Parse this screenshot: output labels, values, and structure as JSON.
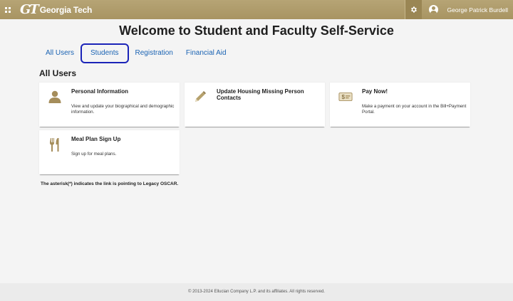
{
  "header": {
    "logo_mark": "GT",
    "logo_text": "Georgia Tech",
    "user_name": "George Patrick Burdell"
  },
  "page": {
    "title": "Welcome to Student and Faculty Self-Service",
    "tabs": [
      {
        "label": "All Users",
        "selected": false
      },
      {
        "label": "Students",
        "selected": true
      },
      {
        "label": "Registration",
        "selected": false
      },
      {
        "label": "Financial Aid",
        "selected": false
      }
    ],
    "section_title": "All Users",
    "cards": [
      {
        "title": "Personal Information",
        "description": "View and update your biographical and demographic information.",
        "icon": "person-icon"
      },
      {
        "title": "Update Housing Missing Person Contacts",
        "description": "",
        "icon": "pencil-icon"
      },
      {
        "title": "Pay Now!",
        "description": "Make a payment on your account in the Bill+Payment Portal.",
        "icon": "dollar-bill-icon"
      },
      {
        "title": "Meal Plan Sign Up",
        "description": "Sign up for meal plans.",
        "icon": "utensils-icon"
      }
    ],
    "footnote": "The asterisk(*) indicates the link is pointing to Legacy OSCAR."
  },
  "footer": {
    "copyright": "© 2013-2024 Ellucian Company L.P. and its affiliates. All rights reserved."
  },
  "colors": {
    "header_gold": "#b3a369",
    "link_blue": "#1a63b3",
    "focus_outline": "#1b24b8"
  }
}
